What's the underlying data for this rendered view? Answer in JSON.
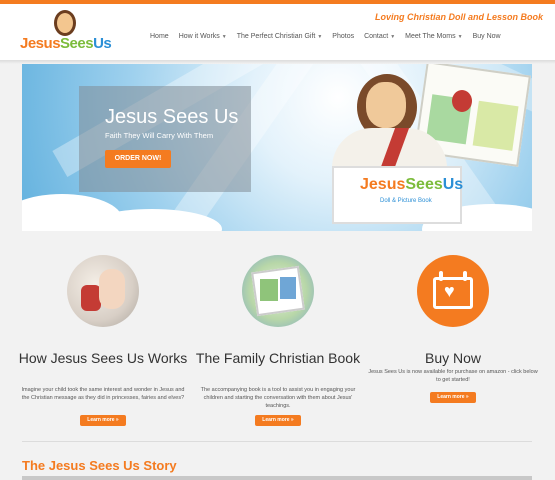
{
  "colors": {
    "accent": "#f47b20",
    "green": "#7cbc3b",
    "blue": "#2b8fd6"
  },
  "header": {
    "logo": {
      "word1": "Jesus",
      "word2": "Sees",
      "word3": "Us"
    },
    "tagline": "Loving Christian Doll and Lesson Book",
    "nav": [
      {
        "label": "Home",
        "active": true,
        "dropdown": false
      },
      {
        "label": "How it Works",
        "active": false,
        "dropdown": true
      },
      {
        "label": "The Perfect Christian Gift",
        "active": false,
        "dropdown": true
      },
      {
        "label": "Photos",
        "active": false,
        "dropdown": false
      },
      {
        "label": "Contact",
        "active": false,
        "dropdown": true
      },
      {
        "label": "Meet The Moms",
        "active": false,
        "dropdown": true
      },
      {
        "label": "Buy Now",
        "active": false,
        "dropdown": false
      }
    ]
  },
  "hero": {
    "title": "Jesus Sees Us",
    "subtitle": "Faith They Will Carry With Them",
    "cta": "ORDER NOW!",
    "box_label_1": "Jesus",
    "box_label_2": "Sees",
    "box_label_3": "Us",
    "box_sub": "Doll & Picture Book"
  },
  "features": [
    {
      "title": "How Jesus Sees Us Works",
      "text": "Imagine your child took the same interest and wonder in Jesus and the Christian message as they did in princesses, fairies and elves?",
      "button": "Learn more »",
      "icon": "hands-photo"
    },
    {
      "title": "The Family Christian Book",
      "text": "The accompanying book is a tool to assist you in engaging your children and starting the conversation with them about Jesus' teachings.",
      "button": "Learn more »",
      "icon": "book-photo"
    },
    {
      "title": "Buy Now",
      "text": "Jesus Sees Us is now available for purchase on amazon - click below to get started!",
      "button": "Learn more »",
      "icon": "heart-calendar-icon"
    }
  ],
  "story": {
    "title": "The Jesus Sees Us Story"
  }
}
